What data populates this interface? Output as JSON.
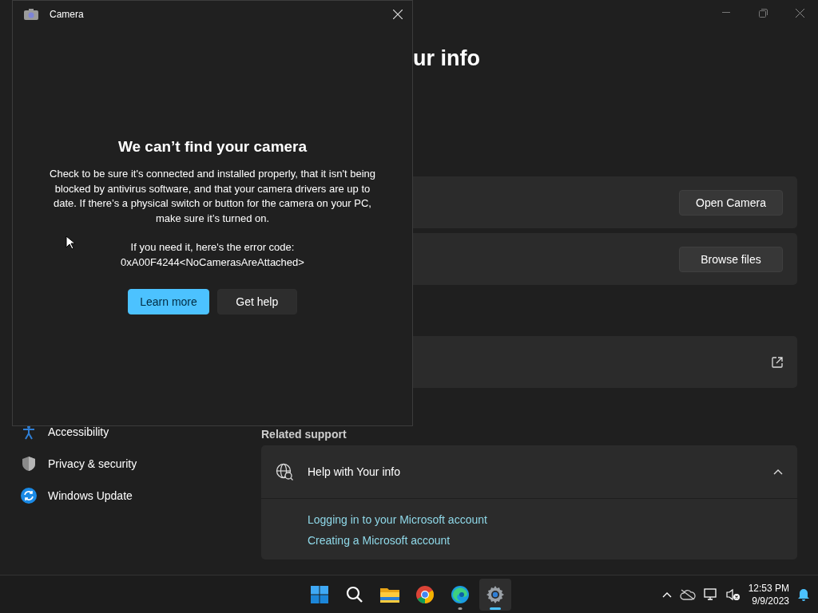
{
  "camera_dialog": {
    "title": "Camera",
    "heading": "We can’t find your camera",
    "message": "Check to be sure it's connected and installed properly, that it isn't being blocked by antivirus software, and that your camera drivers are up to date. If there’s a physical switch or button for the camera on your PC, make sure it’s turned on.",
    "error_label": "If you need it, here's the error code:",
    "error_code": "0xA00F4244<NoCamerasAreAttached>",
    "buttons": [
      {
        "label": "Learn more",
        "kind": "primary"
      },
      {
        "label": "Get help",
        "kind": "secondary"
      }
    ]
  },
  "settings": {
    "heading": "ur info",
    "sidebar": [
      {
        "label": "Accessibility",
        "kind": "accessibility"
      },
      {
        "label": "Privacy & security",
        "kind": "privacy"
      },
      {
        "label": "Windows Update",
        "kind": "update"
      }
    ],
    "cards": [
      {
        "kind": "button",
        "button": "Open Camera"
      },
      {
        "kind": "button",
        "button": "Browse files"
      },
      {
        "kind": "link"
      }
    ],
    "related_support": "Related support",
    "help": {
      "title": "Help with Your info",
      "expanded": true,
      "links": [
        "Logging in to your Microsoft account",
        "Creating a Microsoft account"
      ]
    }
  },
  "taskbar": {
    "apps": [
      {
        "kind": "start",
        "selected": false,
        "running": false
      },
      {
        "kind": "search",
        "selected": false,
        "running": false
      },
      {
        "kind": "files",
        "selected": false,
        "running": false
      },
      {
        "kind": "chrome",
        "selected": false,
        "running": false
      },
      {
        "kind": "edge",
        "selected": false,
        "running": true
      },
      {
        "kind": "settings",
        "selected": true,
        "running": true
      }
    ],
    "time": "12:53 PM",
    "date": "9/9/2023"
  }
}
